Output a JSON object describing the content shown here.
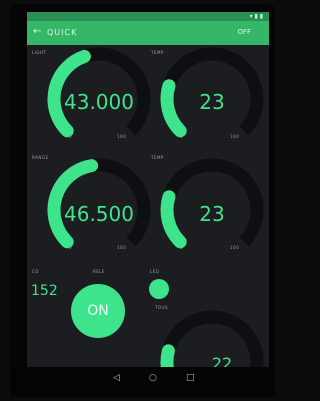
{
  "status_bar": {
    "icons": "▾ ▮ ▮"
  },
  "app_bar": {
    "title": "QUICK",
    "back_glyph": "←",
    "action": "OFF"
  },
  "gauges": [
    {
      "label": "LIGHT",
      "value_text": "43.000",
      "min_label": "0",
      "max_label": "100",
      "level": 0.43
    },
    {
      "label": "TEMP",
      "value_text": "23",
      "min_label": "0",
      "max_label": "100",
      "level": 0.23
    },
    {
      "label": "RANGE",
      "value_text": "46.500",
      "min_label": "0",
      "max_label": "100",
      "level": 0.465
    },
    {
      "label": "TEMP",
      "value_text": "23",
      "min_label": "0",
      "max_label": "100",
      "level": 0.23
    },
    {
      "label": "",
      "value_text": "22",
      "min_label": "",
      "max_label": "",
      "level": 0.22
    }
  ],
  "controls": {
    "counter_label": "CO",
    "counter_value": "152",
    "relay_label": "RELE",
    "button_label": "ON",
    "led_label": "LED",
    "led_sub_label": "TOUS"
  },
  "nav": {
    "back": "◁",
    "home": "○",
    "recents": "□"
  },
  "colors": {
    "accent": "#3ee48b",
    "track": "#0e0f10",
    "appbar": "#34b867"
  }
}
